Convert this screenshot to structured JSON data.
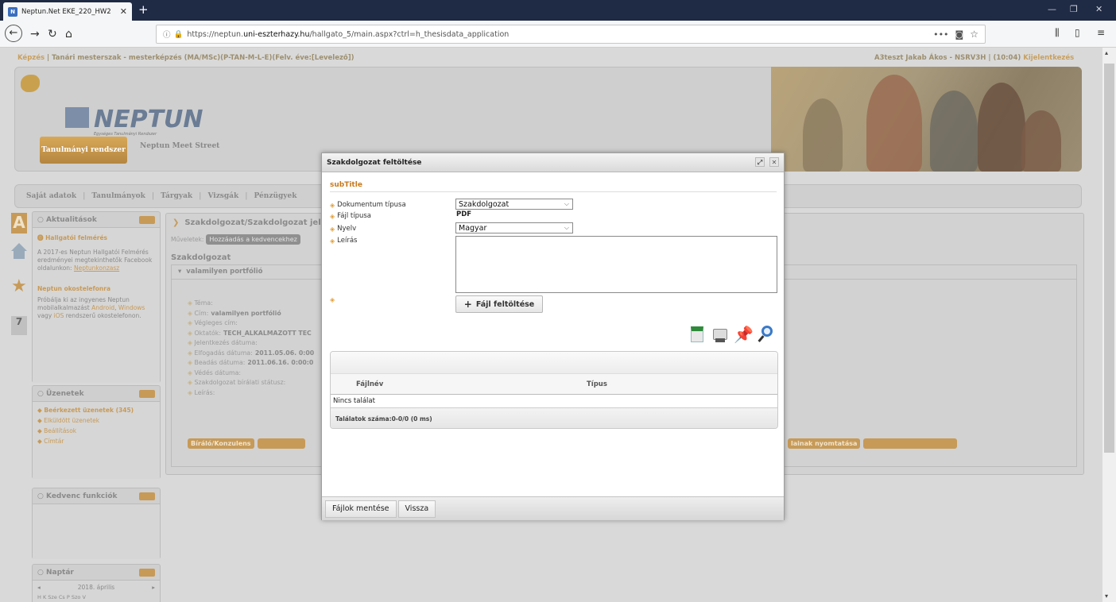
{
  "browser": {
    "tab_title": "Neptun.Net EKE_220_HW2",
    "tab_icon_text": "N",
    "url_prefix": "https://neptun.",
    "url_domain": "uni-eszterhazy.hu",
    "url_path": "/hallgato_5/main.aspx?ctrl=h_thesisdata_application",
    "menu_dots": "•••"
  },
  "page": {
    "training": "Képzés",
    "training_path": " | Tanári mesterszak - mesterképzés (MA/MSc)(P-TAN-M-L-E)(Felv. éve:[Levelező])",
    "user_info": "A3teszt Jakab Ákos - NSRV3H | (10:04)",
    "logout": "Kijelentkezés",
    "logo": "NEPTUN",
    "logo_sub": "Egységes Tanulmányi Rendszer",
    "tab_system": "Tanulmányi rendszer",
    "tab_meet": "Neptun Meet Street",
    "menu": [
      "Saját adatok",
      "Tanulmányok",
      "Tárgyak",
      "Vizsgák",
      "Pénzügyek"
    ],
    "news_title": "Aktualitások",
    "news_item1_title": "Hallgatói felmérés",
    "news_item1_body": "A 2017-es Neptun Hallgatói Felmérés eredményei megtekinthetők Facebook oldalunkon:",
    "news_item1_link": "Neptunkonzasz",
    "news_item2_title": "Neptun okostelefonra",
    "news_item2_body_a": "Próbálja ki az ingyenes Neptun mobilalkalmazást",
    "news_item2_android": "Android",
    "news_item2_windows": "Windows",
    "news_item2_vagy": "vagy",
    "news_item2_ios": "iOS",
    "news_item2_body_b": "rendszerű okostelefonon.",
    "messages_title": "Üzenetek",
    "messages_items": [
      "Beérkezett üzenetek (345)",
      "Elküldött üzenetek",
      "Beállítások",
      "Címtár"
    ],
    "favorites_title": "Kedvenc funkciók",
    "calendar_title": "Naptár",
    "calendar_month": "2018. április",
    "calendar_days": "H  K  Sze  Cs  P  Szo  V",
    "calendar_day_num": "7",
    "breadcrumb": "Szakdolgozat/Szakdolgozat jel",
    "actions_label": "Műveletek:",
    "add_favorite": "Hozzáadás a kedvencekhez",
    "section_title": "Szakdolgozat",
    "portfolio_title": "valamilyen portfólió",
    "fields": [
      {
        "label": "Téma:",
        "value": ""
      },
      {
        "label": "Cím:",
        "value": "valamilyen portfólió"
      },
      {
        "label": "Végleges cím:",
        "value": ""
      },
      {
        "label": "Oktatók:",
        "value": "TECH_ALKALMAZOTT TEC"
      },
      {
        "label": "Jelentkezés dátuma:",
        "value": ""
      },
      {
        "label": "Elfogadás dátuma:",
        "value": "2011.05.06. 0:00"
      },
      {
        "label": "Beadás dátuma:",
        "value": "2011.06.16. 0:00:0"
      },
      {
        "label": "Védés dátuma:",
        "value": ""
      },
      {
        "label": "Szakdolgozat bírálati státusz:",
        "value": ""
      },
      {
        "label": "Leírás:",
        "value": ""
      }
    ],
    "btn_reviewer": "Bíráló/Konzulens",
    "btn_print": "lainak nyomtatása"
  },
  "dialog": {
    "title": "Szakdolgozat feltöltése",
    "subtitle": "subTitle",
    "doc_type_label": "Dokumentum típusa",
    "doc_type_value": "Szakdolgozat",
    "file_type_label": "Fájl típusa",
    "file_type_value": "PDF",
    "language_label": "Nyelv",
    "language_value": "Magyar",
    "description_label": "Leírás",
    "upload_button": "Fájl feltöltése",
    "grid_col_filename": "Fájlnév",
    "grid_col_type": "Típus",
    "no_results": "Nincs találat",
    "results_count": "Találatok száma:0-0/0 (0 ms)",
    "save_button": "Fájlok mentése",
    "back_button": "Vissza"
  },
  "colors": {
    "accent_orange": "#c87a1c",
    "diamond": "#e0a03c",
    "brown_button": "#c79a58"
  }
}
